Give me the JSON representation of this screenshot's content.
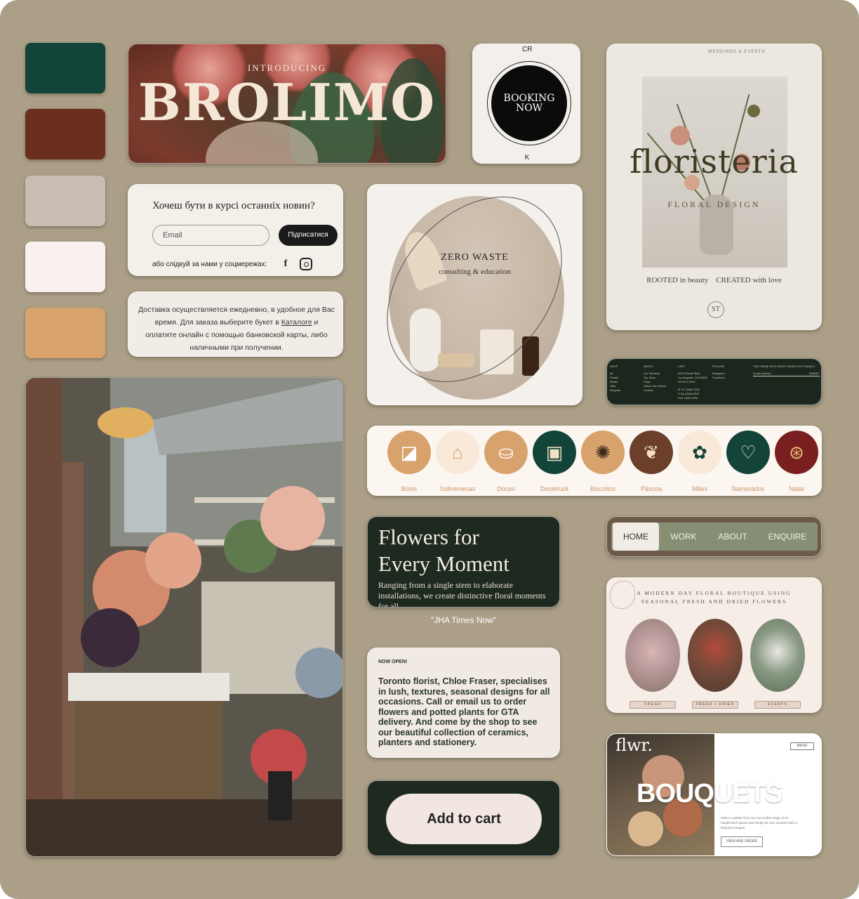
{
  "colors": {
    "background": "#ab9f87",
    "swatches": [
      "#13443a",
      "#6b2e1f",
      "#c8bdb5",
      "#f8f1ed",
      "#d8a26c"
    ]
  },
  "brolimo": {
    "intro": "INTRODUCING",
    "title": "BROLIMO"
  },
  "booking": {
    "label_line1": "BOOKING",
    "label_line2": "NOW",
    "side_top": "CR",
    "side_bottom": "K"
  },
  "floristeria": {
    "vertical": "WEDDINGS & EVENTS",
    "title": "floristeria",
    "subtitle": "FLORAL DESIGN",
    "tagline": "ROOTED in beauty    CREATED with love",
    "monogram": "ST"
  },
  "newsletter": {
    "question": "Хочеш бути в курсі останніх новин?",
    "email_placeholder": "Email",
    "subscribe": "Підписатися",
    "follow": "або слідкуй за нами у соцмережах:",
    "icons": [
      "facebook-icon",
      "instagram-icon"
    ]
  },
  "delivery": {
    "text_before": "Доставка осуществляется ежедневно,  в удобное для Вас время. Для заказа выберите букет в ",
    "link": "Каталоге",
    "text_after": " и оплатите онлайн с помощью банковской карты, либо наличными при получении."
  },
  "zero_waste": {
    "title": "ZERO WASTE",
    "subtitle": "consulting & education"
  },
  "footer": {
    "columns": [
      {
        "head": "SHOP",
        "lines": [
          "All",
          "Florals",
          "Plants",
          "Gifts",
          "Bespoke"
        ]
      },
      {
        "head": "ABOUT",
        "lines": [
          "Our Services",
          "Our Story",
          "FAQs",
          "Where We Deliver",
          "Contact"
        ]
      },
      {
        "head": "VISIT",
        "lines": [
          "5974 Sunset Blvd",
          "Los Angeles, CA 90028",
          "323.871.2010",
          "",
          "M-Th 10AM-7PM",
          "F-Sa 10AM-8PM",
          "Sun 10AM-4PM"
        ]
      },
      {
        "head": "FOLLOW",
        "lines": [
          "Instagram",
          "Facebook"
        ]
      },
      {
        "head": "THE PINNIE WHO ENJOY WHEN JUST EMAILS",
        "lines": [
          "Email Address"
        ]
      }
    ],
    "submit": "SUBMIT"
  },
  "icon_strip": [
    {
      "label": "Bolos",
      "icon": "cake-slice-icon",
      "bg": "#d8a26c",
      "fg": "#ffffff"
    },
    {
      "label": "Sobremesas",
      "icon": "dessert-icon",
      "bg": "#f8e9d9",
      "fg": "#d8a26c"
    },
    {
      "label": "Doces",
      "icon": "cupcake-icon",
      "bg": "#d8a26c",
      "fg": "#ffffff"
    },
    {
      "label": "Docetruck",
      "icon": "food-truck-icon",
      "bg": "#13443a",
      "fg": "#f3e0c5"
    },
    {
      "label": "Biscoitos",
      "icon": "cookie-icon",
      "bg": "#d8a26c",
      "fg": "#3a2a1e"
    },
    {
      "label": "Páscoa",
      "icon": "bunny-icon",
      "bg": "#6b3f2a",
      "fg": "#f3e0c5"
    },
    {
      "label": "Mães",
      "icon": "flower-icon",
      "bg": "#f8e9d9",
      "fg": "#13443a"
    },
    {
      "label": "Namorados",
      "icon": "heart-icon",
      "bg": "#13443a",
      "fg": "#f3e0c5"
    },
    {
      "label": "Natal",
      "icon": "ornament-icon",
      "bg": "#7a1f1f",
      "fg": "#e6b97a"
    }
  ],
  "flowers_card": {
    "title_line1": "Flowers for",
    "title_line2": "Every Moment",
    "description": "Ranging from a single stem to elaborate installations, we create distinctive floral moments for all.",
    "caption": "\"JHA Times Now\""
  },
  "nav": {
    "items": [
      "HOME",
      "WORK",
      "ABOUT",
      "ENQUIRE"
    ],
    "active": "HOME"
  },
  "now_open": {
    "label": "NOW OPEN!",
    "body": "Toronto florist, Chloe Fraser, specialises in lush, textures, seasonal designs for all occasions. Call or email us to order flowers and potted plants for GTA delivery. And come by the shop to see our beautiful collection of ceramics, planters and stationery."
  },
  "boutique": {
    "heading_line1": "A MODERN DAY FLORAL BOUTIQUE USING",
    "heading_line2": "SEASONAL FRESH AND DRIED FLOWERS",
    "buttons": [
      "FRESH",
      "FRESH + DRIED",
      "EVENTS"
    ]
  },
  "cart": {
    "label": "Add to cart"
  },
  "flwr": {
    "logo": "flwr.",
    "menu": "MENU",
    "title": "BOUQUETS",
    "description": "Select a palette from our immovable range of six handpicked options and simply let your recipient with a bespoke bouquet.",
    "cta": "VIEW AND ORDER"
  }
}
